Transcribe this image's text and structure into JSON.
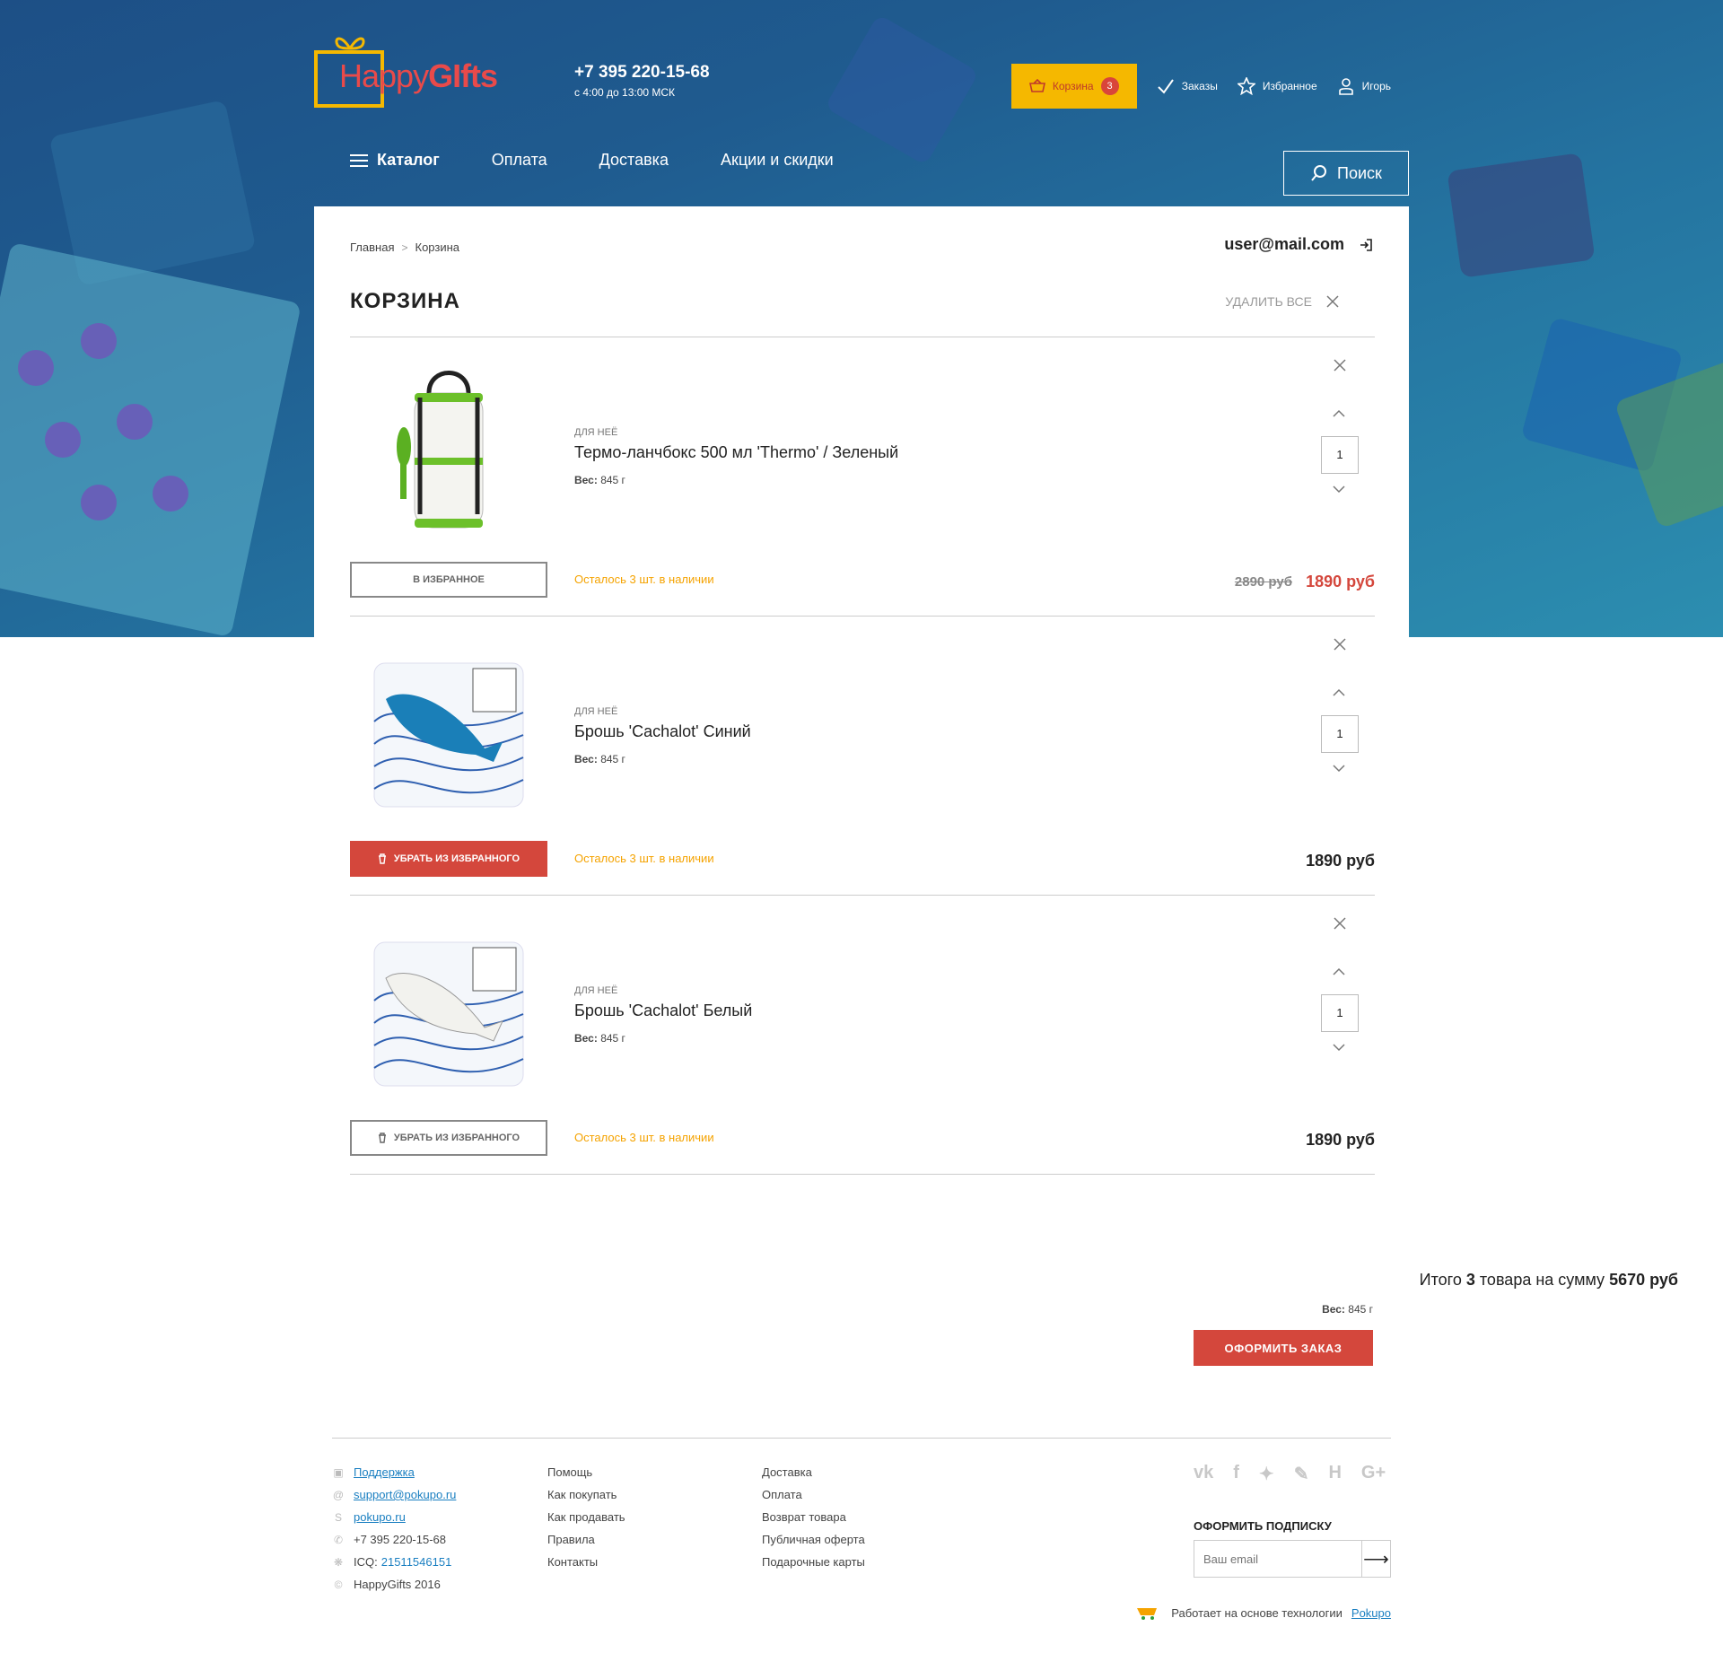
{
  "brand": {
    "name_a": "Happy",
    "name_b": "GIfts",
    "accent": "#f5b800",
    "red": "#d4473c"
  },
  "header": {
    "phone": "+7 395 220-15-68",
    "hours": "с 4:00 до 13:00 МСК",
    "cart_label": "Корзина",
    "cart_count": "3",
    "orders_label": "Заказы",
    "favorites_label": "Избранное",
    "user_label": "Игорь"
  },
  "nav": {
    "catalog": "Каталог",
    "payment": "Оплата",
    "delivery": "Доставка",
    "promo": "Акции и скидки",
    "search": "Поиск"
  },
  "breadcrumb": {
    "home": "Главная",
    "current": "Корзина"
  },
  "account": {
    "email": "user@mail.com"
  },
  "cart": {
    "title": "КОРЗИНА",
    "clear_all": "УДАЛИТЬ ВСЕ",
    "items": [
      {
        "category": "ДЛЯ НЕЁ",
        "name": "Термо-ланчбокс 500 мл 'Thermo' / Зеленый",
        "weight_label": "Вес:",
        "weight": "845 г",
        "fav_button": "В ИЗБРАННОЕ",
        "stock": "Осталось 3 шт. в наличии",
        "old_price": "2890 руб",
        "price": "1890 руб",
        "qty": "1"
      },
      {
        "category": "ДЛЯ НЕЁ",
        "name": "Брошь 'Cachalot' Синий",
        "weight_label": "Вес:",
        "weight": "845 г",
        "fav_button": "УБРАТЬ ИЗ ИЗБРАННОГО",
        "stock": "Осталось 3 шт. в наличии",
        "price": "1890 руб",
        "qty": "1"
      },
      {
        "category": "ДЛЯ НЕЁ",
        "name": "Брошь 'Cachalot' Белый",
        "weight_label": "Вес:",
        "weight": "845 г",
        "fav_button": "УБРАТЬ ИЗ ИЗБРАННОГО",
        "stock": "Осталось 3 шт. в наличии",
        "price": "1890 руб",
        "qty": "1"
      }
    ],
    "summary": {
      "prefix": "Итого",
      "count": "3",
      "middle": "товара на сумму",
      "total": "5670 руб",
      "weight_label": "Вес:",
      "weight": "845 г",
      "order_button": "ОФОРМИТЬ ЗАКАЗ"
    }
  },
  "footer": {
    "contacts": {
      "support": "Поддержка",
      "email": "support@pokupo.ru",
      "skype": "pokupo.ru",
      "phone": "+7 395 220-15-68",
      "icq_label": "ICQ:",
      "icq": "21511546151",
      "copyright": "HappyGifts 2016"
    },
    "col2": [
      "Помощь",
      "Как покупать",
      "Как продавать",
      "Правила",
      "Контакты"
    ],
    "col3": [
      "Доставка",
      "Оплата",
      "Возврат товара",
      "Публичная оферта",
      "Подарочные карты"
    ],
    "social": [
      "vk-icon",
      "facebook-icon",
      "twitter-icon",
      "livejournal-icon",
      "habr-icon",
      "google-plus-icon"
    ],
    "subscribe_title": "ОФОРМИТЬ ПОДПИСКУ",
    "subscribe_placeholder": "Ваш email",
    "powered_text": "Работает на основе технологии",
    "powered_link": "Pokupo"
  }
}
